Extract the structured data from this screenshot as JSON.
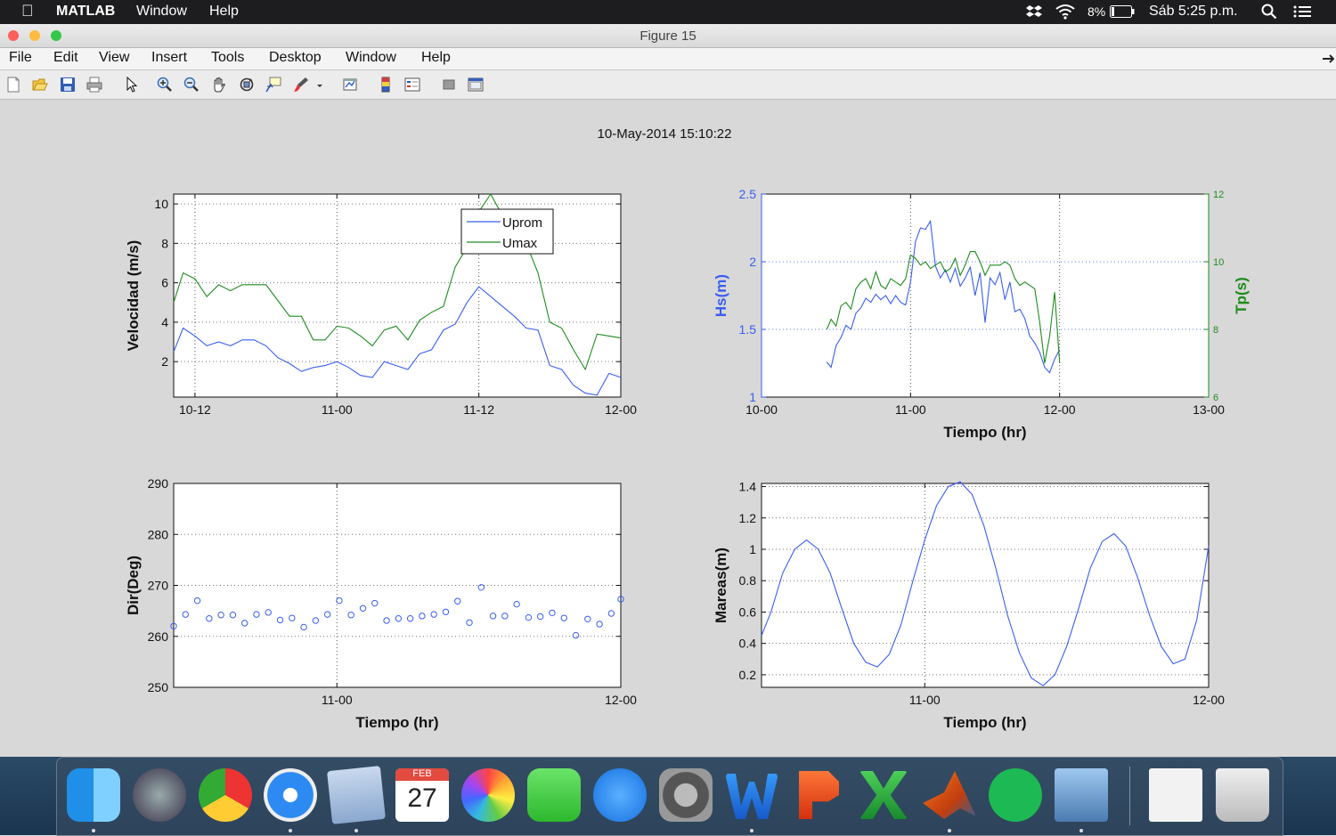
{
  "menubar": {
    "app_name": "MATLAB",
    "items": [
      "Window",
      "Help"
    ],
    "battery": "8%",
    "clock": "Sáb 5:25 p.m."
  },
  "window": {
    "title": "Figure 15"
  },
  "figure_menu": [
    "File",
    "Edit",
    "View",
    "Insert",
    "Tools",
    "Desktop",
    "Window",
    "Help"
  ],
  "toolbar_icons": [
    "new-figure-icon",
    "open-file-icon",
    "save-icon",
    "print-icon",
    "select-arrow-icon",
    "zoom-in-icon",
    "zoom-out-icon",
    "pan-hand-icon",
    "rotate-3d-icon",
    "data-cursor-icon",
    "brush-icon",
    "brush-dropdown-icon",
    "link-plot-icon",
    "colorbar-icon",
    "legend-icon",
    "hide-plot-tools-icon",
    "show-plot-tools-icon"
  ],
  "figure_title": "10-May-2014 15:10:22",
  "colors": {
    "blue": "#3a5ef0",
    "green": "#1e8c1e",
    "bg": "#d8d8d8"
  },
  "dock_apps": [
    "finder-icon",
    "launchpad-icon",
    "chrome-icon",
    "safari-icon",
    "mail-icon",
    "calendar-icon",
    "photos-icon",
    "facetime-icon",
    "app-store-icon",
    "system-preferences-icon",
    "word-icon",
    "powerpoint-icon",
    "excel-icon",
    "matlab-icon",
    "spotify-icon",
    "preview-icon",
    "documents-stack-icon",
    "trash-icon"
  ],
  "dock_calendar": {
    "month": "FEB",
    "day": "27"
  },
  "chart_data": [
    {
      "type": "line",
      "ylabel": "Velocidad (m/s)",
      "xlabel": "",
      "x_ticks": [
        {
          "t": 12,
          "label": "10-12"
        },
        {
          "t": 24,
          "label": "11-00"
        },
        {
          "t": 36,
          "label": "11-12"
        },
        {
          "t": 48,
          "label": "12-00"
        }
      ],
      "xlim": [
        10.2,
        48
      ],
      "ylim": [
        0.2,
        10.5
      ],
      "y_ticks": [
        2,
        4,
        6,
        8,
        10
      ],
      "grid": true,
      "legend": "top-center",
      "series": [
        {
          "name": "Uprom",
          "color": "#3a5ef0",
          "x": [
            10.2,
            11,
            12,
            13,
            14,
            15,
            16,
            17,
            18,
            19,
            20,
            21,
            22,
            23,
            24,
            25,
            26,
            27,
            28,
            29,
            30,
            31,
            32,
            33,
            34,
            35,
            36,
            37,
            38,
            39,
            40,
            41,
            42,
            43,
            44,
            45,
            46,
            47,
            48
          ],
          "y": [
            2.5,
            3.7,
            3.3,
            2.8,
            3.0,
            2.8,
            3.1,
            3.1,
            2.8,
            2.2,
            1.9,
            1.5,
            1.7,
            1.8,
            2.0,
            1.7,
            1.3,
            1.2,
            2.0,
            1.8,
            1.6,
            2.4,
            2.6,
            3.6,
            3.9,
            5.0,
            5.8,
            5.3,
            4.8,
            4.3,
            3.7,
            3.6,
            1.8,
            1.6,
            0.8,
            0.4,
            0.3,
            1.4,
            1.2
          ]
        },
        {
          "name": "Umax",
          "color": "#1e8c1e",
          "x": [
            10.2,
            11,
            12,
            13,
            14,
            15,
            16,
            17,
            18,
            19,
            20,
            21,
            22,
            23,
            24,
            25,
            26,
            27,
            28,
            29,
            30,
            31,
            32,
            33,
            34,
            35,
            36,
            37,
            38,
            39,
            40,
            41,
            42,
            43,
            44,
            45,
            46,
            47,
            48
          ],
          "y": [
            5.0,
            6.5,
            6.2,
            5.3,
            5.9,
            5.6,
            5.9,
            5.9,
            5.9,
            5.1,
            4.3,
            4.3,
            3.1,
            3.1,
            3.8,
            3.7,
            3.3,
            2.8,
            3.6,
            3.8,
            3.1,
            4.1,
            4.5,
            4.8,
            6.8,
            7.8,
            9.6,
            10.5,
            9.4,
            8.6,
            8.0,
            6.5,
            4.0,
            3.7,
            2.6,
            1.6,
            3.4,
            3.3,
            3.2
          ]
        }
      ]
    },
    {
      "type": "line",
      "ylabel": "Hs(m)",
      "ylabel_right": "Tp(s)",
      "xlabel": "Tiempo (hr)",
      "x_ticks": [
        {
          "t": 0,
          "label": "10-00"
        },
        {
          "t": 24,
          "label": "11-00"
        },
        {
          "t": 48,
          "label": "12-00"
        },
        {
          "t": 72,
          "label": "13-00"
        }
      ],
      "xlim": [
        0,
        72
      ],
      "ylim": [
        1,
        2.5
      ],
      "y_ticks": [
        1,
        1.5,
        2,
        2.5
      ],
      "ylim_right": [
        6,
        12
      ],
      "y_ticks_right": [
        6,
        8,
        10,
        12
      ],
      "grid": true,
      "series": [
        {
          "name": "Hs",
          "axis": "left",
          "color": "#3a5ef0",
          "x": [
            10.5,
            11.2,
            12,
            12.8,
            13.6,
            14.4,
            15.2,
            16,
            16.8,
            17.6,
            18.4,
            19.2,
            20,
            20.8,
            21.6,
            22.4,
            23.2,
            24,
            24.8,
            25.6,
            26.4,
            27.2,
            28,
            28.8,
            29.6,
            30.4,
            31.2,
            32,
            32.8,
            33.6,
            34.4,
            35.2,
            36,
            36.8,
            37.6,
            38.4,
            39.2,
            40,
            40.8,
            41.6,
            42.4,
            43.2,
            44,
            44.8,
            45.6,
            46.4,
            47.2,
            48
          ],
          "y": [
            1.26,
            1.22,
            1.38,
            1.44,
            1.53,
            1.5,
            1.62,
            1.66,
            1.73,
            1.7,
            1.76,
            1.72,
            1.75,
            1.69,
            1.75,
            1.7,
            1.68,
            1.85,
            2.15,
            2.25,
            2.24,
            2.3,
            1.97,
            1.88,
            1.94,
            1.85,
            1.95,
            1.82,
            1.88,
            1.96,
            1.75,
            1.92,
            1.55,
            1.88,
            1.83,
            1.92,
            1.72,
            1.85,
            1.63,
            1.65,
            1.58,
            1.45,
            1.4,
            1.33,
            1.22,
            1.18,
            1.28,
            1.35
          ]
        },
        {
          "name": "Tp",
          "axis": "right",
          "color": "#1e8c1e",
          "x": [
            10.5,
            11.2,
            12,
            12.8,
            13.6,
            14.4,
            15.2,
            16,
            16.8,
            17.6,
            18.4,
            19.2,
            20,
            20.8,
            21.6,
            22.4,
            23.2,
            24,
            24.8,
            25.6,
            26.4,
            27.2,
            28,
            28.8,
            29.6,
            30.4,
            31.2,
            32,
            32.8,
            33.6,
            34.4,
            35.2,
            36,
            36.8,
            37.6,
            38.4,
            39.2,
            40,
            40.8,
            41.6,
            42.4,
            43.2,
            44,
            44.8,
            45.6,
            46.4,
            47.2,
            48
          ],
          "y": [
            8.0,
            8.3,
            8.1,
            8.7,
            8.8,
            8.6,
            9.2,
            9.4,
            9.5,
            9.2,
            9.7,
            9.3,
            9.2,
            9.5,
            9.4,
            9.3,
            9.5,
            10.2,
            10.1,
            9.9,
            10.0,
            9.8,
            9.9,
            10.0,
            9.7,
            9.8,
            10.1,
            9.6,
            9.9,
            10.3,
            10.3,
            10.0,
            9.6,
            9.9,
            9.9,
            9.9,
            10.0,
            9.9,
            9.5,
            9.3,
            9.4,
            9.3,
            9.2,
            8.2,
            7.0,
            7.8,
            9.1,
            7.0
          ]
        }
      ]
    },
    {
      "type": "scatter",
      "ylabel": "Dir(Deg)",
      "xlabel": "Tiempo (hr)",
      "x_ticks": [
        {
          "t": 24,
          "label": "11-00"
        },
        {
          "t": 48,
          "label": "12-00"
        }
      ],
      "xlim": [
        10.2,
        48
      ],
      "ylim": [
        250,
        290
      ],
      "y_ticks": [
        250,
        260,
        270,
        280,
        290
      ],
      "grid": true,
      "series": [
        {
          "name": "Dir",
          "color": "#3a5ef0",
          "x": [
            10.2,
            11.2,
            12.2,
            13.2,
            14.2,
            15.2,
            16.2,
            17.2,
            18.2,
            19.2,
            20.2,
            21.2,
            22.2,
            23.2,
            24.2,
            25.2,
            26.2,
            27.2,
            28.2,
            29.2,
            30.2,
            31.2,
            32.2,
            33.2,
            34.2,
            35.2,
            36.2,
            37.2,
            38.2,
            39.2,
            40.2,
            41.2,
            42.2,
            43.2,
            44.2,
            45.2,
            46.2,
            47.2,
            48
          ],
          "y": [
            262,
            264.3,
            267,
            263.5,
            264.2,
            264.2,
            262.6,
            264.3,
            264.7,
            263.2,
            263.6,
            261.8,
            263.1,
            264.3,
            267,
            264.2,
            265.5,
            266.5,
            263.1,
            263.5,
            263.5,
            264,
            264.3,
            264.8,
            266.9,
            262.7,
            269.6,
            264,
            264,
            266.3,
            263.7,
            263.9,
            264.6,
            263.6,
            260.2,
            263.4,
            262.4,
            264.5,
            267.3
          ]
        }
      ]
    },
    {
      "type": "line",
      "ylabel": "Mareas(m)",
      "xlabel": "Tiempo (hr)",
      "x_ticks": [
        {
          "t": 24,
          "label": "11-00"
        },
        {
          "t": 48,
          "label": "12-00"
        }
      ],
      "xlim": [
        10.2,
        48
      ],
      "ylim": [
        0.12,
        1.42
      ],
      "y_ticks": [
        0.2,
        0.4,
        0.6,
        0.8,
        1,
        1.2,
        1.4
      ],
      "grid": true,
      "series": [
        {
          "name": "Mareas",
          "color": "#3a5ef0",
          "x": [
            10.2,
            11,
            12,
            13,
            14,
            15,
            16,
            17,
            18,
            19,
            20,
            21,
            22,
            23,
            24,
            25,
            26,
            27,
            28,
            29,
            30,
            31,
            32,
            33,
            34,
            35,
            36,
            37,
            38,
            39,
            40,
            41,
            42,
            43,
            44,
            45,
            46,
            47,
            48
          ],
          "y": [
            0.45,
            0.6,
            0.85,
            1.0,
            1.06,
            1.0,
            0.85,
            0.62,
            0.4,
            0.28,
            0.25,
            0.33,
            0.52,
            0.8,
            1.06,
            1.28,
            1.4,
            1.43,
            1.35,
            1.15,
            0.88,
            0.58,
            0.34,
            0.18,
            0.13,
            0.2,
            0.38,
            0.62,
            0.88,
            1.05,
            1.1,
            1.02,
            0.82,
            0.58,
            0.38,
            0.27,
            0.3,
            0.55,
            1.02
          ]
        }
      ]
    }
  ]
}
